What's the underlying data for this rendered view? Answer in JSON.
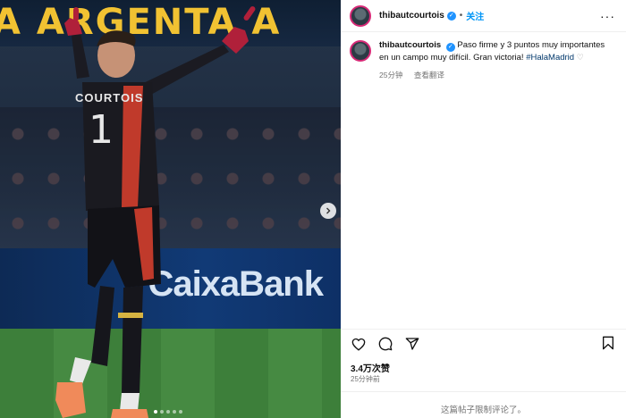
{
  "media": {
    "banner_text": "A ARGENTA A",
    "ad_text": "CaixaBank",
    "shirt_name": "COURTOIS",
    "shirt_number": "1",
    "carousel_total": 5,
    "carousel_active": 1
  },
  "post": {
    "username": "thibautcourtois",
    "follow_label": "关注",
    "more_label": "···",
    "caption_text": "Paso firme y 3 puntos muy importantes en un campo muy difícil. Gran victoria! ",
    "hashtag": "#HalaMadrid",
    "caption_time": "25分钟",
    "view_translation": "查看翻译",
    "likes": "3.4万次赞",
    "timestamp": "25分钟前",
    "comments_disabled": "这篇帖子限制评论了。"
  },
  "colors": {
    "link_blue": "#0095f6",
    "verified_blue": "#1f93ff",
    "hashtag": "#00376b",
    "muted": "#737373"
  },
  "icons": [
    "heart-icon",
    "comment-icon",
    "share-icon",
    "bookmark-icon",
    "verified-badge-icon",
    "more-options-icon",
    "chevron-right-icon"
  ]
}
